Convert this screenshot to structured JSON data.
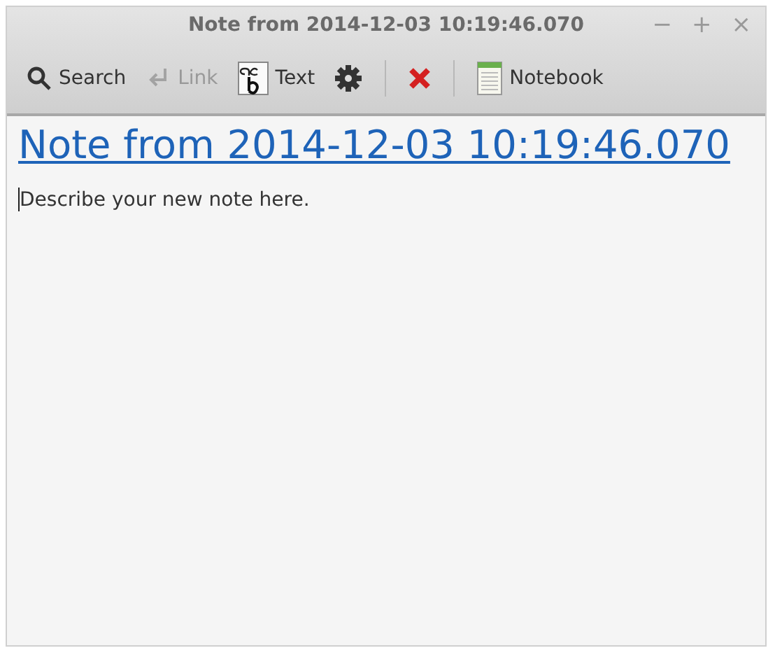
{
  "window": {
    "title": "Note from 2014-12-03 10:19:46.070",
    "controls": [
      "−",
      "+",
      "×"
    ]
  },
  "toolbar": [
    {
      "kind": "search",
      "label": "Search",
      "disabled": false
    },
    {
      "kind": "link",
      "label": "Link",
      "disabled": true
    },
    {
      "kind": "text",
      "label": "Text",
      "disabled": false
    },
    {
      "kind": "settings",
      "disabled": false
    },
    {
      "kind": "separator"
    },
    {
      "kind": "delete",
      "disabled": false
    },
    {
      "kind": "separator"
    },
    {
      "kind": "notebook",
      "label": "Notebook",
      "disabled": false
    }
  ],
  "note": {
    "title": "Note from 2014-12-03 10:19:46.070",
    "body": "Describe your new note here."
  }
}
